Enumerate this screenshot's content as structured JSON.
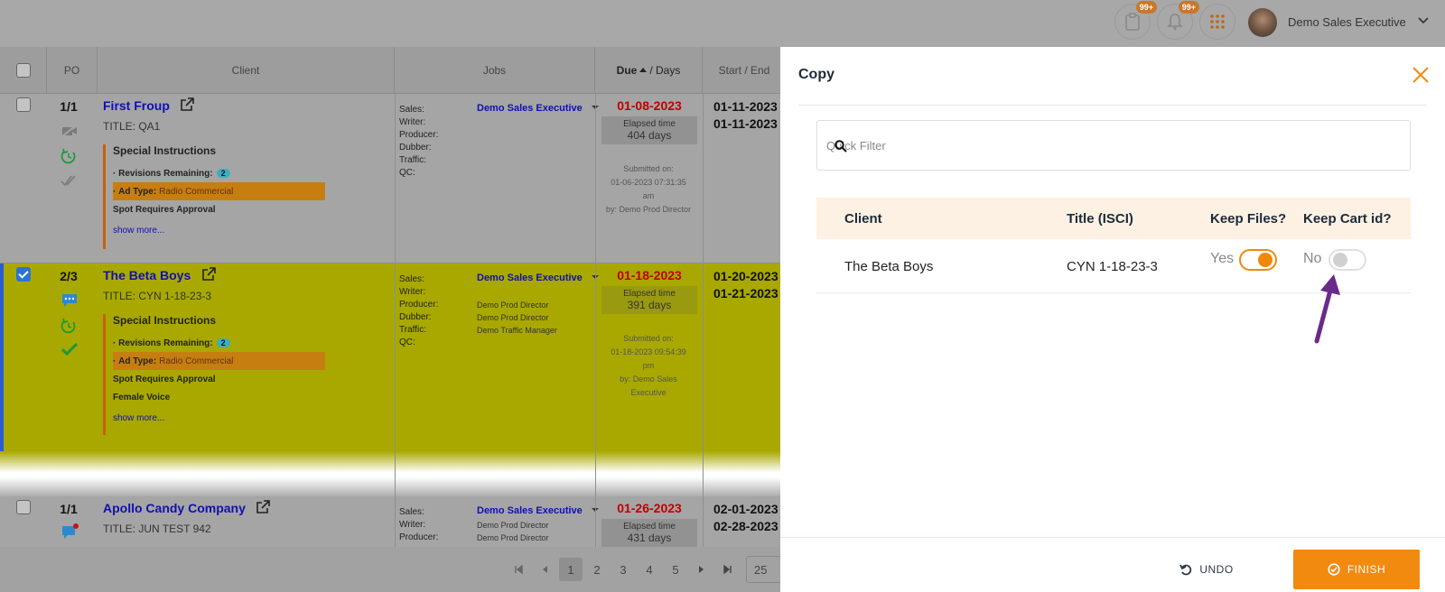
{
  "user": {
    "name": "Demo Sales Executive",
    "notif_badge_1": "99+",
    "notif_badge_2": "99+"
  },
  "grid": {
    "headers": {
      "po": "PO",
      "client": "Client",
      "jobs": "Jobs",
      "due": "Due",
      "days": " / Days",
      "start_end": "Start / End"
    },
    "job_labels": {
      "sales": "Sales:",
      "writer": "Writer:",
      "producer": "Producer:",
      "dubber": "Dubber:",
      "traffic": "Traffic:",
      "qc": "QC:"
    },
    "rows": [
      {
        "po": "1/1",
        "client": "First Froup",
        "title": "TITLE: QA1",
        "si_title": "Special Instructions",
        "rev_label": "Revisions Remaining:",
        "rev_count": "2",
        "ad_type_label": "Ad Type:",
        "ad_type": "Radio Commercial",
        "spot": "Spot Requires Approval",
        "show_more": "show more...",
        "sales": "Demo Sales Executive",
        "producer": "",
        "dubber": "",
        "traffic": "",
        "due": "01-08-2023",
        "elapsed_label": "Elapsed time",
        "elapsed": "404 days",
        "submitted_1": "Submitted on:",
        "submitted_2": "01-06-2023 07:31:35",
        "submitted_3": "am",
        "submitted_4": "by: Demo Prod Director",
        "start": "01-11-2023",
        "end": "01-11-2023"
      },
      {
        "po": "2/3",
        "client": "The Beta Boys",
        "title": "TITLE: CYN 1-18-23-3",
        "si_title": "Special Instructions",
        "rev_label": "Revisions Remaining:",
        "rev_count": "2",
        "ad_type_label": "Ad Type:",
        "ad_type": "Radio Commercial",
        "spot": "Spot Requires Approval",
        "extra": "Female Voice",
        "show_more": "show more...",
        "sales": "Demo Sales Executive",
        "producer": "Demo Prod Director",
        "dubber": "Demo Prod Director",
        "traffic": "Demo Traffic Manager",
        "due": "01-18-2023",
        "elapsed_label": "Elapsed time",
        "elapsed": "391 days",
        "submitted_1": "Submitted on:",
        "submitted_2": "01-18-2023 09:54:39",
        "submitted_3": "pm",
        "submitted_4": "by: Demo Sales",
        "submitted_5": "Executive",
        "start": "01-20-2023",
        "end": "01-21-2023"
      },
      {
        "po": "1/1",
        "client": "Apollo Candy Company",
        "title": "TITLE: JUN TEST 942",
        "sales": "Demo Sales Executive",
        "writer": "Demo Prod Director",
        "producer": "Demo Prod Director",
        "due": "01-26-2023",
        "elapsed_label": "Elapsed time",
        "elapsed": "431 days",
        "start": "02-01-2023",
        "end": "02-28-2023"
      }
    ],
    "pagination": {
      "pages": [
        "1",
        "2",
        "3",
        "4",
        "5"
      ],
      "current": "1",
      "per_page": "25"
    }
  },
  "drawer": {
    "title": "Copy",
    "filter_placeholder": "Quick Filter",
    "columns": {
      "client": "Client",
      "title": "Title (ISCI)",
      "keep_files": "Keep Files?",
      "keep_cart": "Keep Cart id?"
    },
    "rows": [
      {
        "client": "The Beta Boys",
        "title": "CYN 1-18-23-3",
        "keep_files_label": "Yes",
        "keep_files": true,
        "keep_cart_label": "No",
        "keep_cart": false
      }
    ],
    "undo_label": "UNDO",
    "finish_label": "FINISH"
  },
  "colors": {
    "accent": "#f28a10",
    "annotation_arrow": "#6a2a8c",
    "highlight_row": "#a8a800"
  }
}
